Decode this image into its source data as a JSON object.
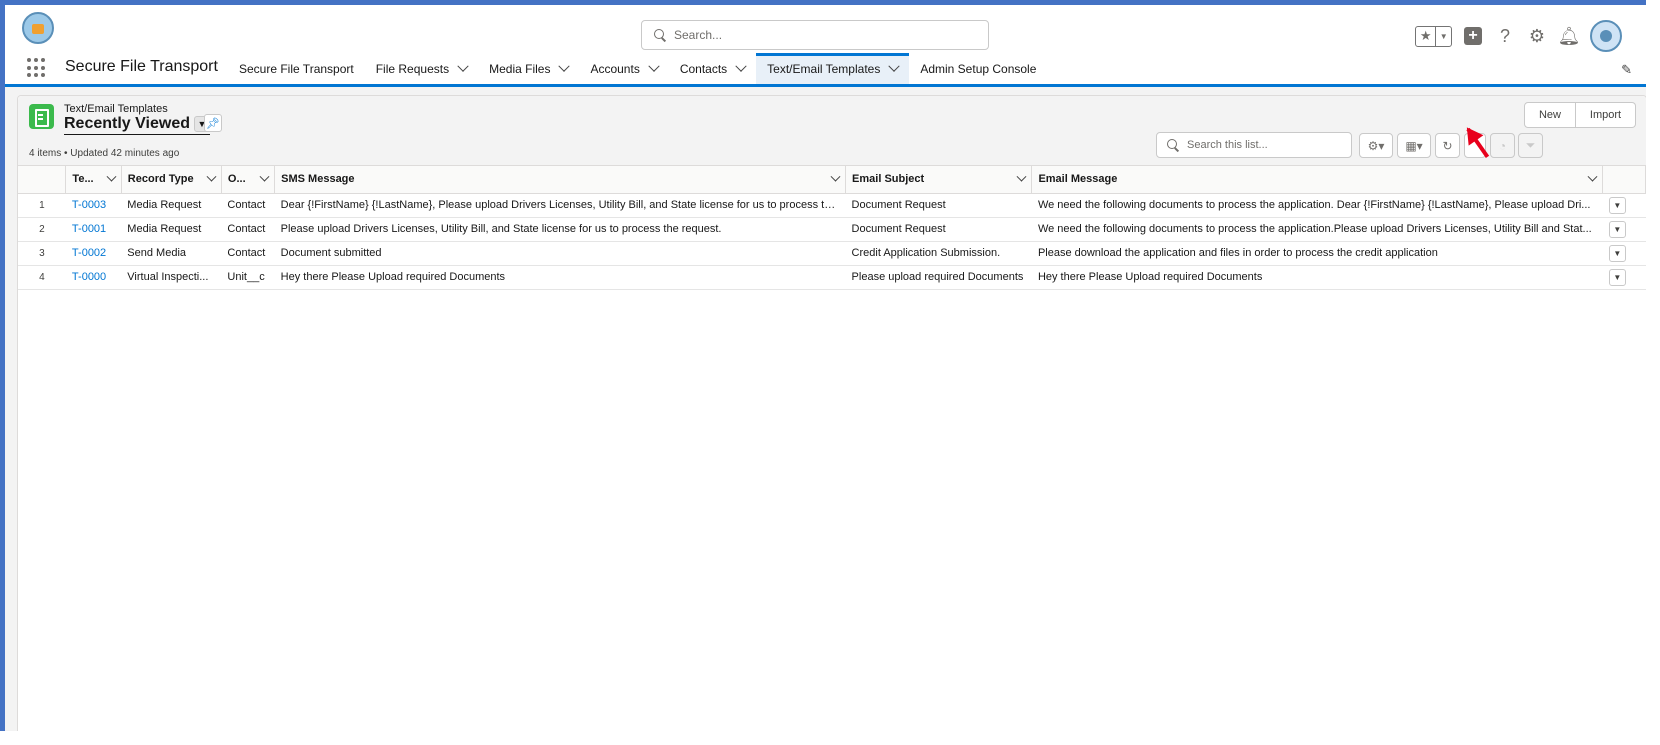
{
  "header": {
    "search_placeholder": "Search...",
    "icons": [
      "favorites-star-icon",
      "add-icon",
      "help-icon",
      "setup-gear-icon",
      "notifications-bell-icon",
      "user-avatar"
    ]
  },
  "nav": {
    "app_name": "Secure File Transport",
    "tabs": [
      {
        "label": "Secure File Transport",
        "has_menu": false
      },
      {
        "label": "File Requests",
        "has_menu": true
      },
      {
        "label": "Media Files",
        "has_menu": true
      },
      {
        "label": "Accounts",
        "has_menu": true
      },
      {
        "label": "Contacts",
        "has_menu": true
      },
      {
        "label": "Text/Email Templates",
        "has_menu": true,
        "active": true
      },
      {
        "label": "Admin Setup Console",
        "has_menu": false
      }
    ]
  },
  "list_view": {
    "object_label": "Text/Email Templates",
    "view_name": "Recently Viewed",
    "meta": "4 items • Updated 42 minutes ago",
    "new_label": "New",
    "import_label": "Import",
    "search_placeholder": "Search this list...",
    "columns": [
      "Te...",
      "Record Type",
      "O...",
      "SMS Message",
      "Email Subject",
      "Email Message"
    ],
    "rows": [
      {
        "num": "1",
        "name": "T-0003",
        "record_type": "Media Request",
        "object": "Contact",
        "sms": "Dear {!FirstName} {!LastName}, Please upload Drivers Licenses, Utility Bill, and State license for us to process the...",
        "subject": "Document Request",
        "email": "We need the following documents to process the application. Dear {!FirstName} {!LastName}, Please upload Dri..."
      },
      {
        "num": "2",
        "name": "T-0001",
        "record_type": "Media Request",
        "object": "Contact",
        "sms": "Please upload Drivers Licenses, Utility Bill, and State license for us to process the request.",
        "subject": "Document Request",
        "email": "We need the following documents to process the application.Please upload Drivers Licenses, Utility Bill and Stat..."
      },
      {
        "num": "3",
        "name": "T-0002",
        "record_type": "Send Media",
        "object": "Contact",
        "sms": "Document submitted",
        "subject": "Credit Application Submission.",
        "email": "Please download the application and files in order to process the credit application"
      },
      {
        "num": "4",
        "name": "T-0000",
        "record_type": "Virtual Inspecti...",
        "object": "Unit__c",
        "sms": "Hey there Please Upload required Documents",
        "subject": "Please upload required Documents",
        "email": "Hey there Please Upload required Documents"
      }
    ]
  },
  "colors": {
    "brand_blue": "#0176d3",
    "frame_blue": "#4472c4",
    "object_icon_green": "#3bba4c",
    "annotation_arrow_red": "#e8001c"
  }
}
